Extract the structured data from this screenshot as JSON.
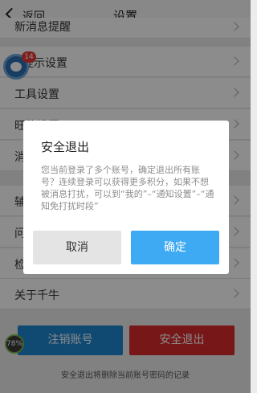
{
  "header": {
    "back_label": "返回",
    "title": "设置"
  },
  "settings": {
    "items": [
      {
        "label": "新消息提醒"
      },
      {
        "label": "提示设置"
      },
      {
        "label": "工具设置"
      },
      {
        "label": "旺信设置"
      },
      {
        "label": "消息设置"
      },
      {
        "label": "辅助功能"
      },
      {
        "label": "问题反馈"
      },
      {
        "label": "检查更新"
      },
      {
        "label": "关于千牛"
      }
    ]
  },
  "actions": {
    "logout_account": "注销账号",
    "safe_exit": "安全退出"
  },
  "hint": "安全退出将删除当前账号密码的记录",
  "floating": {
    "badge": "14",
    "perf": "78%"
  },
  "dialog": {
    "title": "安全退出",
    "message": "您当前登录了多个账号，确定退出所有账号？连续登录可以获得更多积分，如果不想被消息打扰，可以到“我的”–“通知设置”–“通知免打扰时段”",
    "cancel": "取消",
    "confirm": "确定"
  }
}
